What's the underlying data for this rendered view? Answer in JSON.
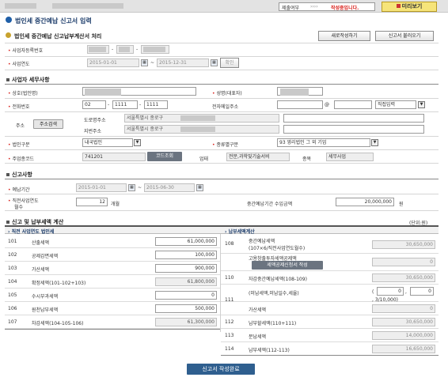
{
  "top": {
    "status_label": "제출여부",
    "status_dots": "››››",
    "status_value": "작성중입니다.",
    "preview_button": "미리보기"
  },
  "title": "법인세 중간예납 신고서 입력",
  "subtitle": "법인세 중간예납 신고납부계산서 처리",
  "new_button": "새로작성하기",
  "load_button": "신고서 불러오기",
  "biz_no_label": "사업자등록번호",
  "year_label": "사업연도",
  "year_from": "2015-01-01",
  "year_to": "2015-12-31",
  "confirm_button": "확인",
  "taxpayer": {
    "title": "사업자 세무사항",
    "company_label": "상호(법인명)",
    "ceo_label": "성명(대표자)",
    "phone_label": "전화번호",
    "phone1": "02",
    "phone2": "1111",
    "phone3": "1111",
    "email_label": "전자메일주소",
    "email_at": "@",
    "email_direct": "직접입력",
    "address_label": "주소",
    "address_search": "주소검색",
    "road_label": "도로명주소",
    "road_value": "서울특별시 종로구",
    "jibun_label": "지번주소",
    "jibun_value": "서울특별시 종로구",
    "corp_type_label": "법인구분",
    "corp_type_value": "내국법인",
    "kind_label": "종류별구분",
    "kind_value": "93 영리법인 그 외 기업",
    "industry_label": "주업종코드",
    "industry_code": "741201",
    "code_search": "코드조회",
    "biz_label": "업태",
    "biz_value": "전문,과학및기술서비",
    "item_label": "종목",
    "item_value": "세무사업"
  },
  "report": {
    "title": "신고사항",
    "period_label": "예납기간",
    "period_from": "2015-01-01",
    "period_to": "2015-06-30",
    "months_label1": "직전사업연도",
    "months_label2": "월수",
    "months_value": "12",
    "months_unit": "개월",
    "income_label": "중간예납기간 수입금액",
    "income_value": "20,000,000",
    "income_unit": "원"
  },
  "calc": {
    "title": "신고 및 납부세액 계산",
    "unit": "(단위:원)",
    "left_header": "직전 사업연도 법인세",
    "right_header": "납부세액계산",
    "left": [
      {
        "no": "101",
        "label": "산출세액",
        "value": "61,000,000"
      },
      {
        "no": "102",
        "label": "공제감면세액",
        "value": "100,000"
      },
      {
        "no": "103",
        "label": "가산세액",
        "value": "900,000"
      },
      {
        "no": "104",
        "label": "확정세액(101-102+103)",
        "value": "61,800,000"
      },
      {
        "no": "105",
        "label": "수시부과세액",
        "value": "0"
      },
      {
        "no": "106",
        "label": "원천납부세액",
        "value": "500,000"
      },
      {
        "no": "107",
        "label": "차감세액(104-105-106)",
        "value": "61,300,000"
      }
    ],
    "r108_no": "108",
    "r108_l1": "중간예납세액",
    "r108_l2": "(107×6/직전사업연도월수)",
    "r108_v": "30,650,000",
    "r109_l1": "고용창출투자세액공제액",
    "r109_btn": "세액공제신청서 작성",
    "r109_v": "0",
    "r110_no": "110",
    "r110_l": "자감중간예납세액(108-109)",
    "r110_v": "30,650,000",
    "r111_no": "111",
    "r111_l": "(미납세액,미납일수,세율)",
    "r111_a": "0",
    "r111_b": "0",
    "r111_rate": "3/10,000)",
    "r111b_l": "가산세액",
    "r111b_v": "0",
    "r112_no": "112",
    "r112_l": "납부할세액(110+111)",
    "r112_v": "30,650,000",
    "r113_no": "113",
    "r113_l": "분납세액",
    "r113_v": "14,000,000",
    "r114_no": "114",
    "r114_l": "납부세액(112-113)",
    "r114_v": "16,650,000"
  },
  "finish_button": "신고서 작성완료",
  "colors": {
    "accent": "#d9221c",
    "header_bar": "#e3e3e3",
    "yellow": "#f6e47a"
  }
}
